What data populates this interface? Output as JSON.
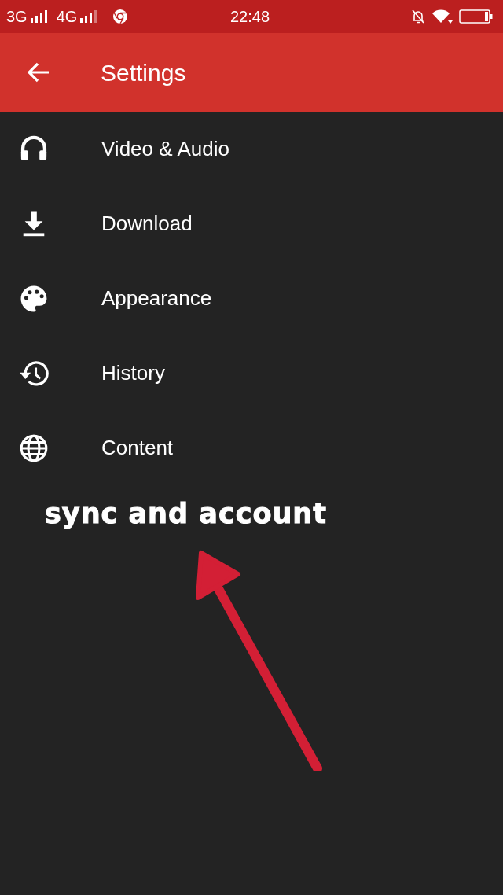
{
  "status_bar": {
    "network_1": "3G",
    "network_2": "4G",
    "time": "22:48"
  },
  "toolbar": {
    "title": "Settings"
  },
  "settings_items": [
    {
      "kind": "headphones",
      "label": "Video & Audio"
    },
    {
      "kind": "download",
      "label": "Download"
    },
    {
      "kind": "palette",
      "label": "Appearance"
    },
    {
      "kind": "history",
      "label": "History"
    },
    {
      "kind": "globe",
      "label": "Content"
    }
  ],
  "annotation": {
    "text": "sync and account"
  }
}
